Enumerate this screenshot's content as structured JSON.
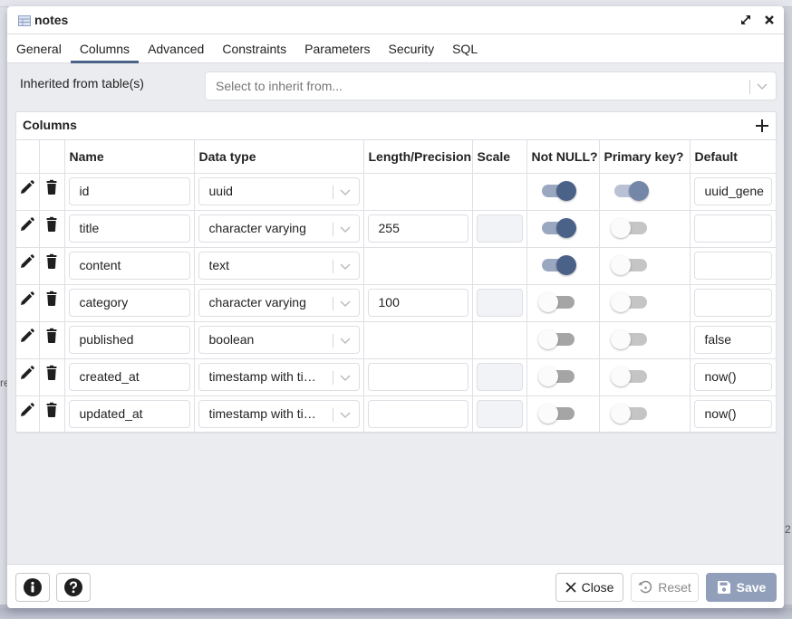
{
  "dialog": {
    "title": "notes",
    "title_icon": "table-icon",
    "maximize_icon": "expand-arrows-icon",
    "close_icon": "close-x-icon"
  },
  "tabs": [
    {
      "label": "General",
      "active": false
    },
    {
      "label": "Columns",
      "active": true
    },
    {
      "label": "Advanced",
      "active": false
    },
    {
      "label": "Constraints",
      "active": false
    },
    {
      "label": "Parameters",
      "active": false
    },
    {
      "label": "Security",
      "active": false
    },
    {
      "label": "SQL",
      "active": false
    }
  ],
  "inherit": {
    "label": "Inherited from table(s)",
    "placeholder": "Select to inherit from..."
  },
  "columns_panel": {
    "title": "Columns",
    "add_icon": "plus-icon",
    "headers": [
      "",
      "",
      "Name",
      "Data type",
      "Length/Precision",
      "Scale",
      "Not NULL?",
      "Primary key?",
      "Default"
    ],
    "rows": [
      {
        "name": "id",
        "data_type": "uuid",
        "length": null,
        "length_editable": false,
        "scale_editable": false,
        "not_null": true,
        "primary_key": true,
        "default": "uuid_gene"
      },
      {
        "name": "title",
        "data_type": "character varying",
        "length": "255",
        "length_editable": true,
        "scale_editable": true,
        "not_null": true,
        "primary_key": false,
        "default": ""
      },
      {
        "name": "content",
        "data_type": "text",
        "length": null,
        "length_editable": false,
        "scale_editable": false,
        "not_null": true,
        "primary_key": false,
        "default": ""
      },
      {
        "name": "category",
        "data_type": "character varying",
        "length": "100",
        "length_editable": true,
        "scale_editable": true,
        "not_null": false,
        "primary_key": false,
        "default": ""
      },
      {
        "name": "published",
        "data_type": "boolean",
        "length": null,
        "length_editable": false,
        "scale_editable": false,
        "not_null": false,
        "primary_key": false,
        "default": "false"
      },
      {
        "name": "created_at",
        "data_type": "timestamp with tim…",
        "length": "",
        "length_editable": true,
        "scale_editable": true,
        "not_null": false,
        "primary_key": false,
        "default": "now()"
      },
      {
        "name": "updated_at",
        "data_type": "timestamp with tim…",
        "length": "",
        "length_editable": true,
        "scale_editable": true,
        "not_null": false,
        "primary_key": false,
        "default": "now()"
      }
    ]
  },
  "footer": {
    "info_icon": "info-circle-icon",
    "help_icon": "question-circle-icon",
    "close_label": "Close",
    "reset_label": "Reset",
    "save_label": "Save"
  },
  "colors": {
    "accent": "#4a6188",
    "save_button": "#919fba",
    "dialog_bg": "#ebecf0"
  },
  "background_fragments": {
    "left": "re",
    "right": "2"
  }
}
